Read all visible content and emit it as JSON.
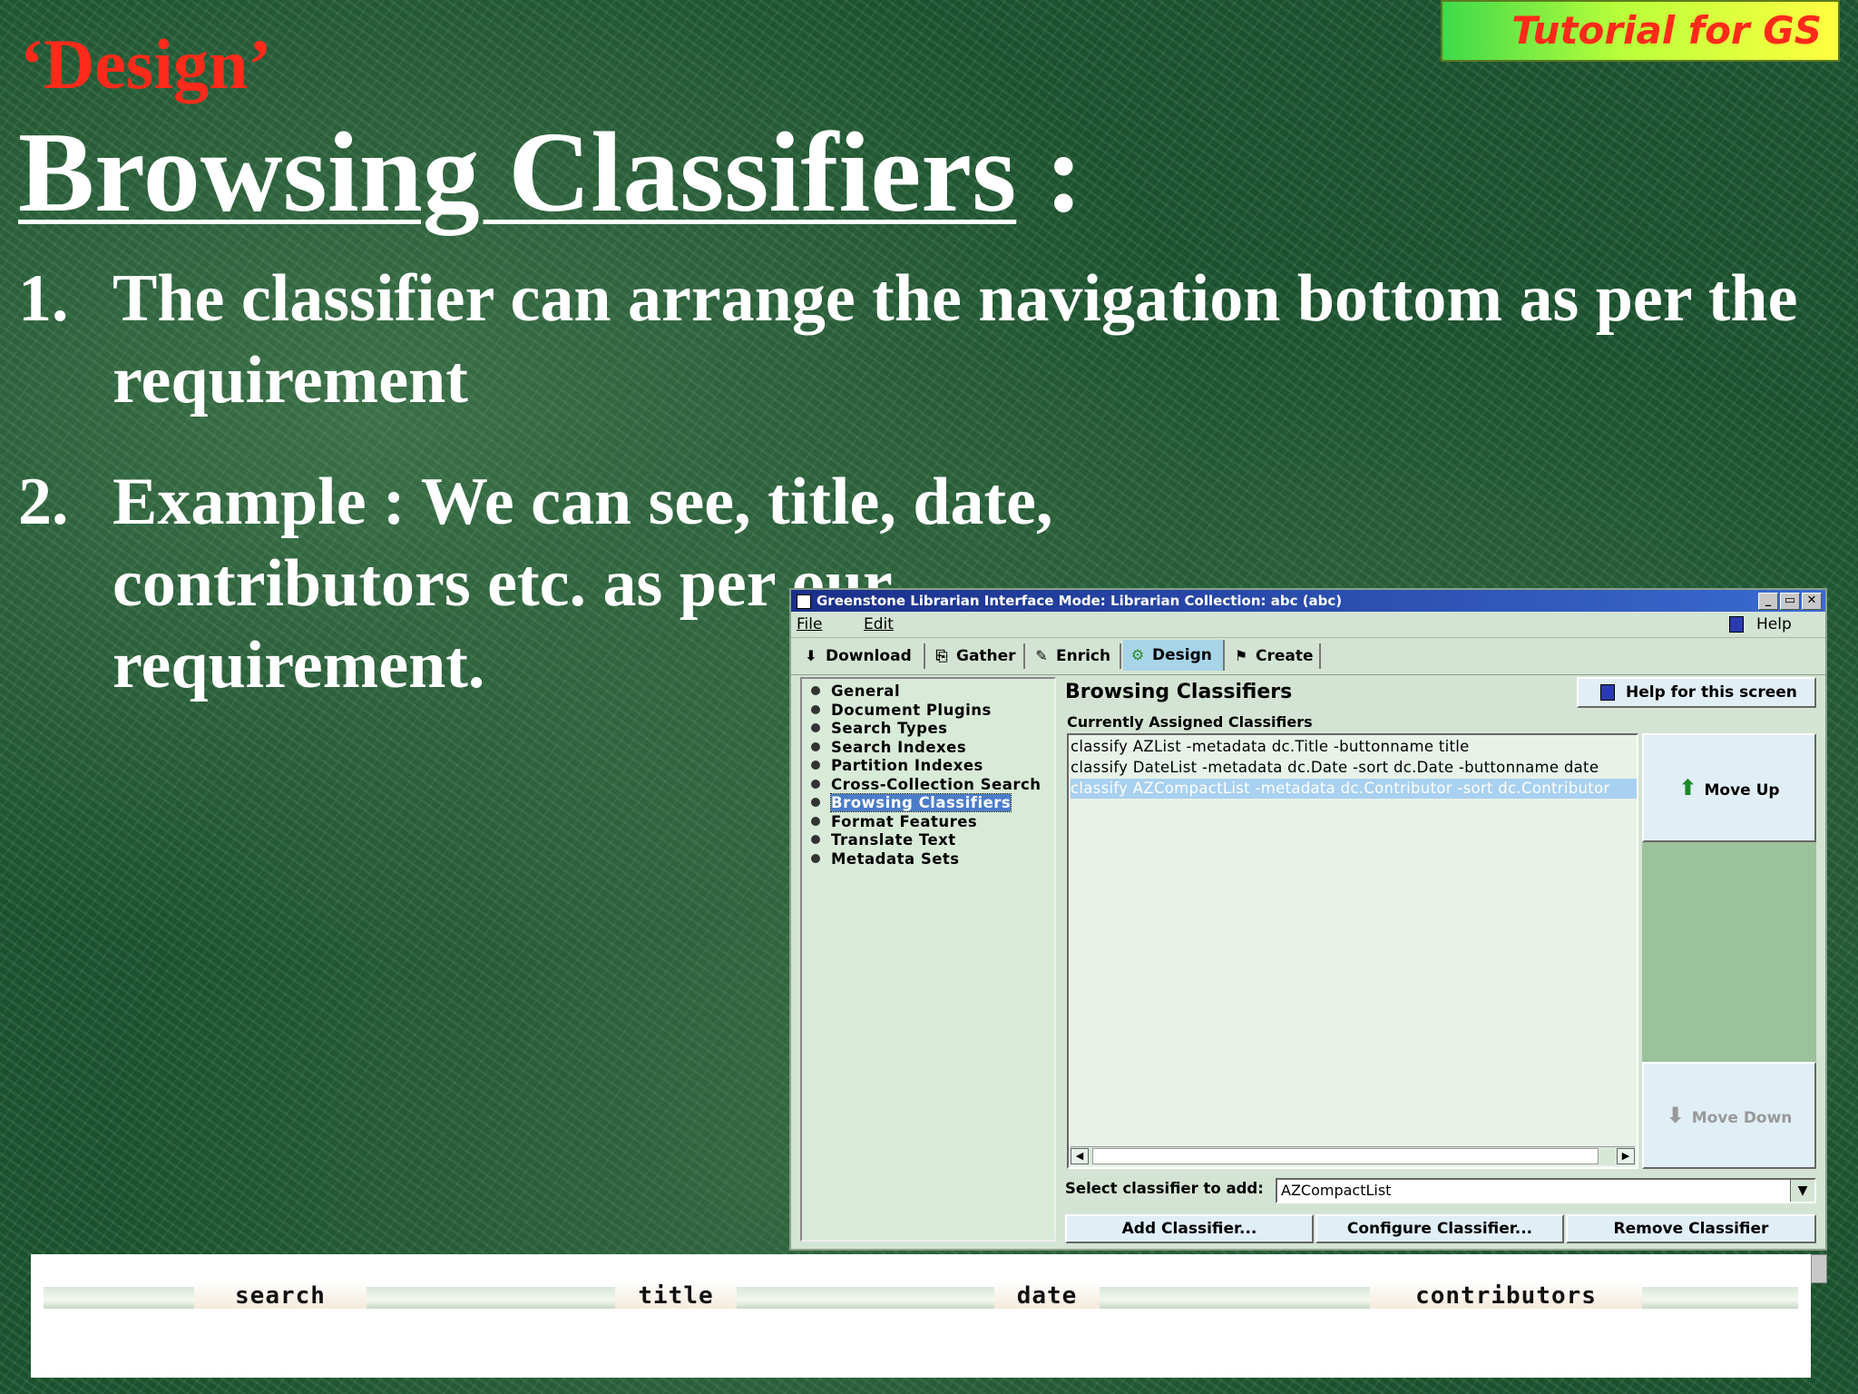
{
  "slide": {
    "section_tag": "‘Design’",
    "badge": "Tutorial for GS",
    "title": "Browsing Classifiers",
    "title_suffix": " :",
    "points": [
      {
        "num": "1.",
        "text": "The classifier can arrange the navigation bottom as per the requirement"
      },
      {
        "num": "2.",
        "text": "Example : We can see, title, date, contributors etc. as per our requirement."
      }
    ]
  },
  "window": {
    "title": "Greenstone Librarian Interface  Mode: Librarian  Collection: abc (abc)",
    "controls": {
      "minimize": "_",
      "maximize": "▭",
      "close": "✕"
    },
    "menu": {
      "file": "File",
      "edit": "Edit",
      "help": "Help"
    },
    "tabs": [
      {
        "label": "Download",
        "icon": "download-icon",
        "glyph": "⬇"
      },
      {
        "label": "Gather",
        "icon": "gather-icon",
        "glyph": "⎘"
      },
      {
        "label": "Enrich",
        "icon": "enrich-icon",
        "glyph": "✎"
      },
      {
        "label": "Design",
        "icon": "design-gear-icon",
        "glyph": "⚙"
      },
      {
        "label": "Create",
        "icon": "create-icon",
        "glyph": "⚑"
      }
    ],
    "active_tab": "Design",
    "sidebar": [
      "General",
      "Document Plugins",
      "Search Types",
      "Search Indexes",
      "Partition Indexes",
      "Cross-Collection Search",
      "Browsing Classifiers",
      "Format Features",
      "Translate Text",
      "Metadata Sets"
    ],
    "sidebar_selected": "Browsing Classifiers",
    "heading": "Browsing Classifiers",
    "help_button": "Help for this screen",
    "assigned_label": "Currently Assigned Classifiers",
    "classifiers": [
      "classify AZList -metadata dc.Title -buttonname title",
      "classify DateList -metadata dc.Date -sort dc.Date -buttonname date",
      "classify AZCompactList -metadata dc.Contributor -sort dc.Contributor"
    ],
    "selected_classifier_index": 2,
    "move_up": "Move Up",
    "move_down": "Move Down",
    "select_label": "Select classifier to add:",
    "select_value": "AZCompactList",
    "buttons": {
      "add": "Add Classifier...",
      "configure": "Configure Classifier...",
      "remove": "Remove Classifier"
    }
  },
  "navbar": {
    "links": [
      "search",
      "title",
      "date",
      "contributors"
    ]
  },
  "colors": {
    "tag_red": "#ff2a1a",
    "window_bg": "#d4e4d4",
    "selection_blue": "#4a7cc8",
    "titlebar_blue": "#1a2f8a"
  }
}
